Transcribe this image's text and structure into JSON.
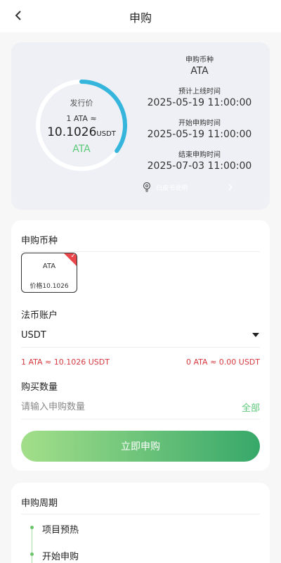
{
  "header": {
    "title": "申购"
  },
  "overview": {
    "ring_label": "发行价",
    "rate_line": "1 ATA ≈",
    "price_value": "10.1026",
    "price_unit": "USDT",
    "coin": "ATA",
    "progress_fraction": 0.35,
    "info": [
      {
        "label": "申购币种",
        "value": "ATA"
      },
      {
        "label": "预计上线时间",
        "value": "2025-05-19 11:00:00"
      },
      {
        "label": "开始申购时间",
        "value": "2025-05-19 11:00:00"
      },
      {
        "label": "结束申购时间",
        "value": "2025-07-03 11:00:00"
      }
    ],
    "tip_text": "白皮书说明"
  },
  "form": {
    "coin_section_title": "申购币种",
    "coin_chip": {
      "coin": "ATA",
      "price": "价格10.1026"
    },
    "account_title": "法币账户",
    "account_value": "USDT",
    "rate_left": "1 ATA ≈ 10.1026 USDT",
    "rate_right": "0 ATA ≈ 0.00 USDT",
    "qty_title": "购买数量",
    "qty_placeholder": "请输入申购数量",
    "qty_value": "",
    "all_label": "全部",
    "submit_label": "立即申购"
  },
  "period": {
    "title": "申购周期",
    "steps": [
      "项目预热",
      "开始申购"
    ]
  },
  "colors": {
    "accent_green": "#5cc97a",
    "ring_blue": "#35b5dc",
    "warning_red": "#d6393f"
  }
}
